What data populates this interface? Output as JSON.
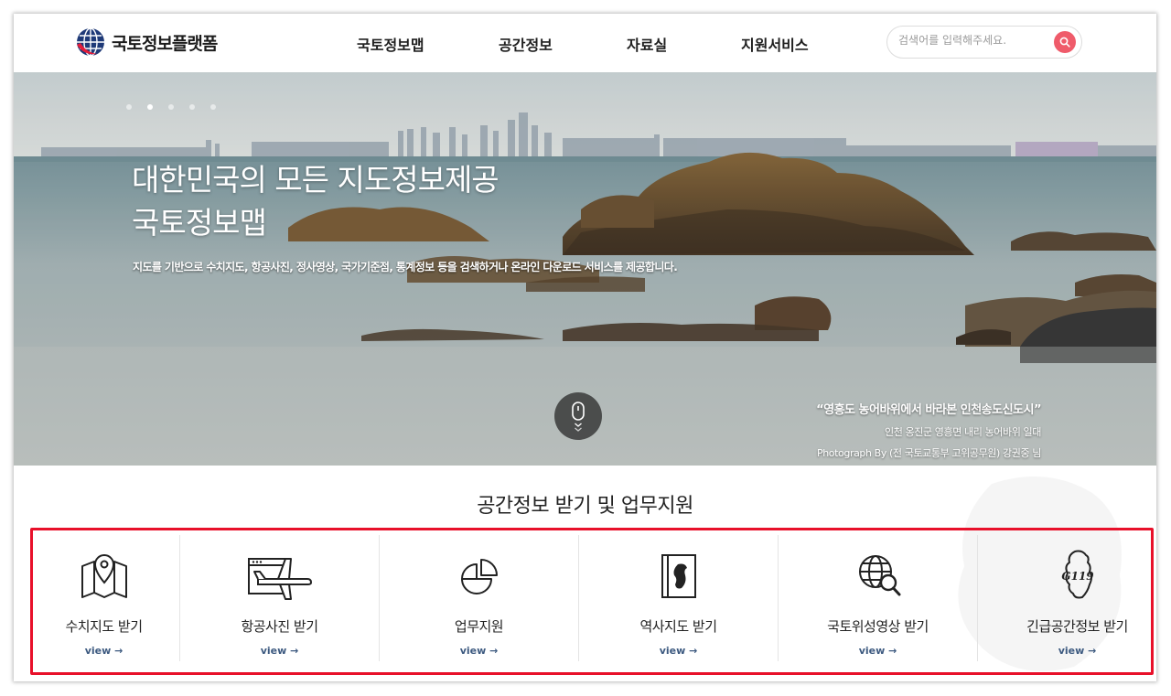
{
  "header": {
    "logo_text": "국토정보플랫폼",
    "nav": [
      "국토정보맵",
      "공간정보",
      "자료실",
      "지원서비스"
    ],
    "search_placeholder": "검색어를 입력해주세요."
  },
  "hero": {
    "slide_count": 5,
    "active_slide": 2,
    "title_line1": "대한민국의 모든 지도정보제공",
    "title_line2": "국토정보맵",
    "description": "지도를 기반으로 수치지도, 항공사진, 정사영상, 국가기준점, 통계정보 등을 검색하거나 온라인 다운로드 서비스를 제공합니다.",
    "photo_title": "“영흥도 농어바위에서 바라본 인천송도신도시”",
    "photo_location": "인천 옹진군 영흥면 내리 농어바위 일대",
    "photo_credit": "Photograph By (전 국토교통부 고위공무원) 강권중 님"
  },
  "services": {
    "title": "공간정보 받기 및 업무지원",
    "view_label": "view →",
    "items": [
      {
        "label": "수치지도 받기",
        "icon": "map-pin-icon"
      },
      {
        "label": "항공사진 받기",
        "icon": "airplane-icon"
      },
      {
        "label": "업무지원",
        "icon": "pie-chart-icon"
      },
      {
        "label": "역사지도 받기",
        "icon": "korea-map-icon"
      },
      {
        "label": "국토위성영상 받기",
        "icon": "globe-search-icon"
      },
      {
        "label": "긴급공간정보 받기",
        "icon": "g119-icon"
      }
    ]
  },
  "colors": {
    "accent": "#ef5b6a",
    "highlight": "#e8102a",
    "view_link": "#3d5a80"
  }
}
